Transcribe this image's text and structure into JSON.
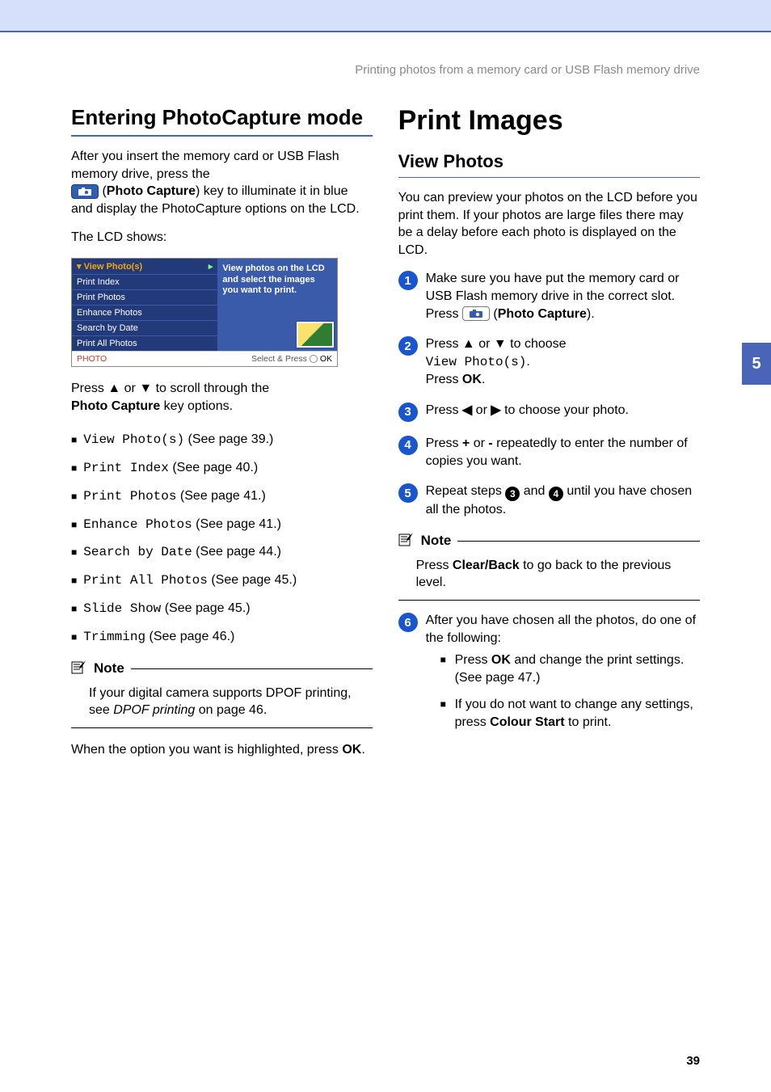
{
  "header": {
    "running_title": "Printing photos from a memory card or USB Flash memory drive"
  },
  "side_tab": "5",
  "page_number": "39",
  "left": {
    "h1": "Entering PhotoCapture mode",
    "intro_a": "After you insert the memory card or USB Flash memory drive, press the",
    "intro_b_pre": " (",
    "intro_b_bold": "Photo Capture",
    "intro_b_post": ") key to illuminate it in blue and display the PhotoCapture options on the LCD.",
    "lcd_shows": "The LCD shows:",
    "lcd": {
      "items": [
        "View Photo(s)",
        "Print Index",
        "Print Photos",
        "Enhance Photos",
        "Search by Date",
        "Print All Photos"
      ],
      "desc": "View photos on the LCD and select the images you want to print.",
      "footer_left": "PHOTO",
      "footer_right": "Select & Press",
      "ok": "OK"
    },
    "scroll_a": "Press ",
    "scroll_b": " or ",
    "scroll_c": " to scroll through the ",
    "scroll_bold": "Photo Capture",
    "scroll_d": " key options.",
    "options": [
      {
        "mono": "View Photo(s)",
        "tail": " (See page 39.)"
      },
      {
        "mono": "Print Index",
        "tail": " (See page 40.)"
      },
      {
        "mono": "Print Photos",
        "tail": " (See page 41.)"
      },
      {
        "mono": "Enhance Photos",
        "tail": " (See page 41.)"
      },
      {
        "mono": "Search by Date",
        "tail": " (See page 44.)"
      },
      {
        "mono": "Print All Photos",
        "tail": " (See page 45.)"
      },
      {
        "mono": "Slide Show",
        "tail": " (See page 45.)"
      },
      {
        "mono": "Trimming",
        "tail": " (See page 46.)"
      }
    ],
    "note_label": "Note",
    "note_body_a": "If your digital camera supports DPOF printing, see ",
    "note_body_italic": "DPOF printing",
    "note_body_b": " on page 46.",
    "closing_a": "When the option you want is highlighted, press ",
    "closing_bold": "OK",
    "closing_b": "."
  },
  "right": {
    "h1": "Print Images",
    "h2": "View Photos",
    "intro": "You can preview your photos on the LCD before you print them. If your photos are large files there may be a delay before each photo is displayed on the LCD.",
    "steps": {
      "s1_a": "Make sure you have put the memory card or USB Flash memory drive in the correct slot.",
      "s1_b_pre": "Press ",
      "s1_b_mid": " (",
      "s1_b_bold": "Photo Capture",
      "s1_b_post": ").",
      "s2_a": "Press ",
      "s2_b": " or ",
      "s2_c": " to choose ",
      "s2_mono": "View Photo(s)",
      "s2_d": ".",
      "s2_e_pre": "Press ",
      "s2_e_bold": "OK",
      "s2_e_post": ".",
      "s3_a": "Press ",
      "s3_b": " or ",
      "s3_c": " to choose your photo.",
      "s4_a": "Press ",
      "s4_plus": "+",
      "s4_b": " or ",
      "s4_minus": "-",
      "s4_c": " repeatedly to enter the number of copies you want.",
      "s5_a": "Repeat steps ",
      "s5_b": " and ",
      "s5_c": " until you have chosen all the photos.",
      "s6": "After you have chosen all the photos, do one of the following:"
    },
    "ref3": "3",
    "ref4": "4",
    "note_label": "Note",
    "note_body_a": "Press ",
    "note_body_bold": "Clear/Back",
    "note_body_b": " to go back to the previous level.",
    "sub": {
      "a_pre": "Press ",
      "a_bold": "OK",
      "a_post": " and change the print settings. (See page 47.)",
      "b_pre": "If you do not want to change any settings, press ",
      "b_bold": "Colour Start",
      "b_post": " to print."
    }
  }
}
